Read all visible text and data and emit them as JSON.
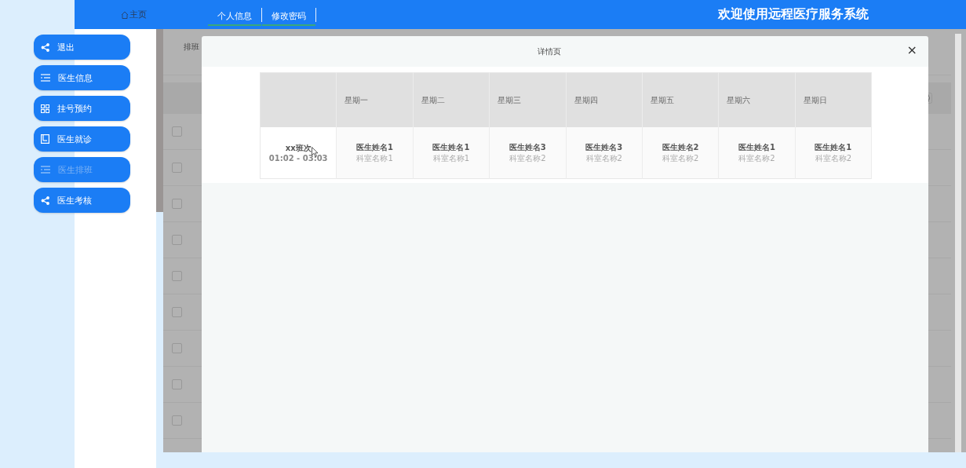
{
  "topbar": {
    "home": "主页",
    "tabs": [
      {
        "label": "个人信息",
        "selected": true
      },
      {
        "label": "修改密码",
        "selected": true
      }
    ],
    "title": "欢迎使用远程医疗服务系统"
  },
  "sidebar": {
    "items": [
      {
        "label": "退出",
        "kind": "share",
        "selected": false
      },
      {
        "label": "医生信息",
        "kind": "list",
        "selected": false
      },
      {
        "label": "挂号预约",
        "kind": "grid",
        "selected": false
      },
      {
        "label": "医生就诊",
        "kind": "book",
        "selected": false
      },
      {
        "label": "医生排班",
        "kind": "list",
        "selected": true
      },
      {
        "label": "医生考核",
        "kind": "share",
        "selected": false
      }
    ]
  },
  "background": {
    "search_label": "排班",
    "rows": [
      {
        "checked": false
      },
      {
        "checked": false
      },
      {
        "checked": false
      },
      {
        "checked": false
      },
      {
        "checked": false
      },
      {
        "checked": false
      },
      {
        "checked": false
      },
      {
        "checked": false
      },
      {
        "checked": false
      }
    ]
  },
  "modal": {
    "title": "详情页",
    "close": "×",
    "table": {
      "columns": [
        "",
        "星期一",
        "星期二",
        "星期三",
        "星期四",
        "星期五",
        "星期六",
        "星期日"
      ],
      "shift": {
        "name": "xx班次",
        "time": "01:02 - 03:03"
      },
      "cells": [
        {
          "doctor": "医生姓名1",
          "dept": "科室名称1"
        },
        {
          "doctor": "医生姓名1",
          "dept": "科室名称1"
        },
        {
          "doctor": "医生姓名3",
          "dept": "科室名称2"
        },
        {
          "doctor": "医生姓名3",
          "dept": "科室名称2"
        },
        {
          "doctor": "医生姓名2",
          "dept": "科室名称2"
        },
        {
          "doctor": "医生姓名1",
          "dept": "科室名称2"
        },
        {
          "doctor": "医生姓名1",
          "dept": "科室名称2"
        }
      ]
    }
  }
}
